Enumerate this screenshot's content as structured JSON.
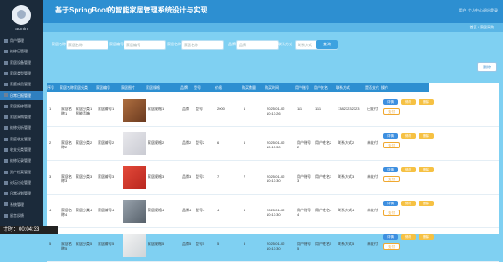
{
  "sidebar": {
    "username": "admin",
    "items": [
      "用户管理",
      "维修日管理",
      "家居设备管理",
      "家居类型管理",
      "家庭成员管理",
      "日常日报管理",
      "家居报修管理",
      "家居采购管理",
      "维修分析管理",
      "家庭收支管理",
      "收支分类管理",
      "维修记录管理",
      "资产档案管理",
      "论坛讨论管理",
      "日常计划管理",
      "系统管理",
      "留言反馈"
    ],
    "active_index": 5
  },
  "header": {
    "title": "基于SpringBoot的智能家居管理系统设计与实现",
    "user": "用户: 个人中心  退出登录"
  },
  "breadcrumb": "首页 / 家居采购",
  "filters": [
    {
      "label": "家居名称",
      "placeholder": "家居名称"
    },
    {
      "label": "家居编号",
      "placeholder": "家居编号"
    },
    {
      "label": "家居名称",
      "placeholder": "家居名称"
    },
    {
      "label": "品牌",
      "placeholder": "品牌"
    },
    {
      "label": "联系方式",
      "placeholder": "联系方式"
    }
  ],
  "search_label": "查询",
  "delete_label": "删除",
  "table": {
    "columns": [
      "序号",
      "家居名称",
      "家居分类",
      "家居编号",
      "家居图片",
      "家居规格",
      "品牌",
      "型号",
      "价格",
      "购买数量",
      "购买时间",
      "用户账号",
      "用户姓名",
      "联系方式",
      "是否支付",
      "操作"
    ],
    "rows": [
      {
        "n": "1",
        "name": "家居名称1",
        "cat": "家居分类1智能音箱",
        "code": "家居编号1",
        "spec": "家居规格1",
        "brand": "品牌",
        "model": "型号",
        "price": "2000",
        "qty": "1",
        "time": "2025-01-02 10:13:26",
        "account": "111",
        "uname": "111",
        "phone": "13823232323",
        "paid": "已支付"
      },
      {
        "n": "2",
        "name": "家居名称2",
        "cat": "家居分类2",
        "code": "家居编号2",
        "spec": "家居规格2",
        "brand": "品牌2",
        "model": "型号2",
        "price": "6",
        "qty": "6",
        "time": "2025-01-02 10:13:30",
        "account": "用户账号2",
        "uname": "用户姓名2",
        "phone": "联系方式2",
        "paid": "未支付"
      },
      {
        "n": "3",
        "name": "家居名称3",
        "cat": "家居分类3",
        "code": "家居编号3",
        "spec": "家居规格3",
        "brand": "品牌3",
        "model": "型号3",
        "price": "7",
        "qty": "7",
        "time": "2025-01-02 10:13:30",
        "account": "用户账号3",
        "uname": "用户姓名3",
        "phone": "联系方式3",
        "paid": "未支付"
      },
      {
        "n": "4",
        "name": "家居名称4",
        "cat": "家居分类4",
        "code": "家居编号4",
        "spec": "家居规格4",
        "brand": "品牌4",
        "model": "型号4",
        "price": "4",
        "qty": "6",
        "time": "2025-01-02 10:13:30",
        "account": "用户账号4",
        "uname": "用户姓名4",
        "phone": "联系方式4",
        "paid": "未支付"
      },
      {
        "n": "5",
        "name": "家居名称5",
        "cat": "家居分类5",
        "code": "家居编号5",
        "spec": "家居规格5",
        "brand": "品牌5",
        "model": "型号5",
        "price": "5",
        "qty": "5",
        "time": "2025-01-02 10:13:30",
        "account": "用户账号5",
        "uname": "用户姓名5",
        "phone": "联系方式5",
        "paid": "未支付"
      }
    ],
    "ops": [
      "详情",
      "修改",
      "删除",
      "支付"
    ]
  },
  "timer": "计时：00:04:33",
  "colors": {
    "sidebar": "#1b2a3a",
    "header": "#2d8fd1",
    "page": "#7fd0f2",
    "accent": "#f6c143"
  }
}
